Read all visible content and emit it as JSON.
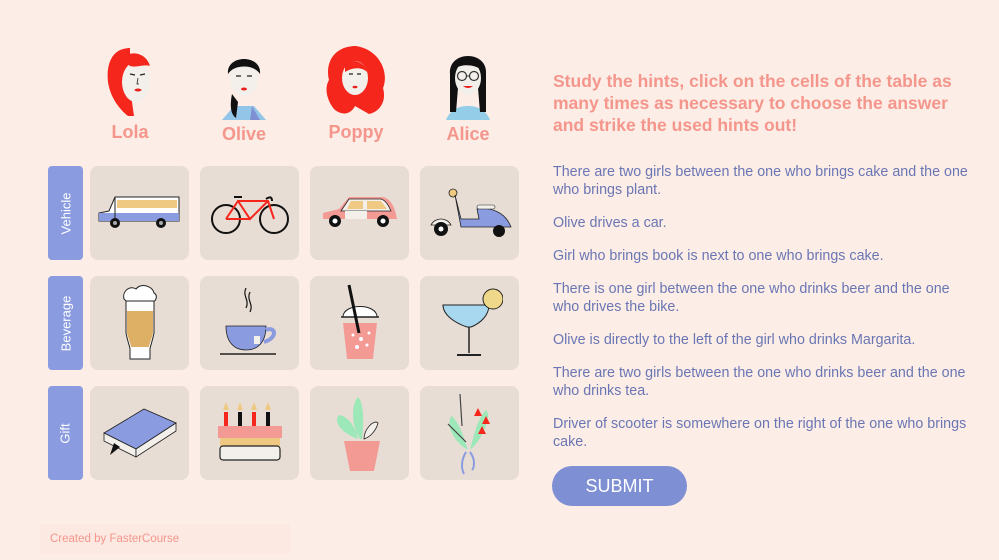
{
  "girls": [
    {
      "name": "Lola"
    },
    {
      "name": "Olive"
    },
    {
      "name": "Poppy"
    },
    {
      "name": "Alice"
    }
  ],
  "rows": [
    {
      "label": "Vehicle",
      "items": [
        "bus-icon",
        "bicycle-icon",
        "car-icon",
        "scooter-icon"
      ]
    },
    {
      "label": "Beverage",
      "items": [
        "beer-icon",
        "tea-icon",
        "soda-icon",
        "margarita-icon"
      ]
    },
    {
      "label": "Gift",
      "items": [
        "book-icon",
        "cake-icon",
        "plant-icon",
        "bouquet-icon"
      ]
    }
  ],
  "instructions": "Study the hints, click on the cells of the table as many times as necessary to choose the answer and strike the used hints out!",
  "hints": [
    "There are two girls between the one who brings cake and the one who brings plant.",
    "Olive drives a car.",
    "Girl who brings book is next to one who brings cake.",
    "There is one girl between the one who drinks beer and the one who drives the bike.",
    "Olive is directly to the left of the girl who drinks Margarita.",
    "There are two girls between the one who drinks beer and the one who drinks tea.",
    "Driver of scooter is somewhere on the right of the one who brings cake."
  ],
  "submit_label": "SUBMIT",
  "credit": "Created by FasterCourse",
  "colors": {
    "background": "#fcede6",
    "accent_pink": "#f5968c",
    "accent_blue": "#8a9be0",
    "hint_text": "#6a76b4",
    "cell_bg": "#e8ddd4"
  }
}
